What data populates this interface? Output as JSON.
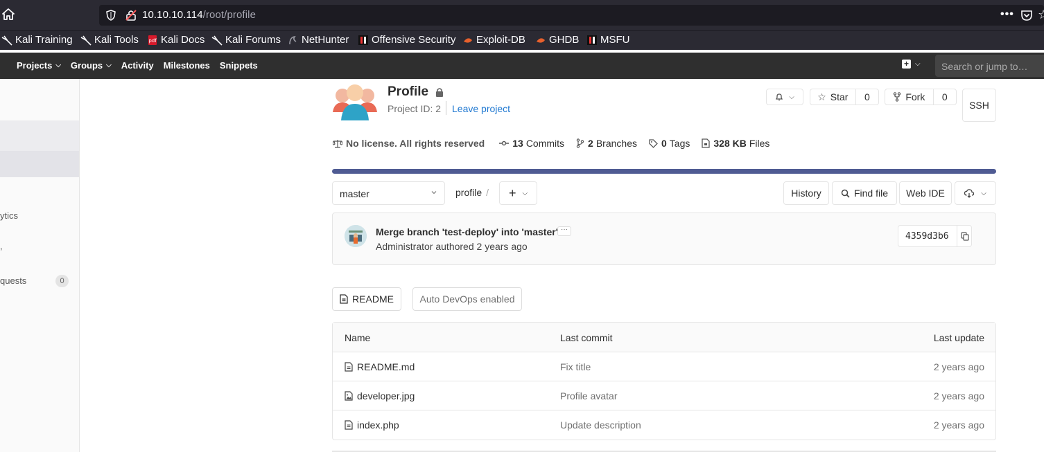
{
  "browser": {
    "url_host": "10.10.10.114",
    "url_path": "/root/profile",
    "bookmarks": [
      {
        "label": "Kali Training",
        "icon": "kali-dragon-icon"
      },
      {
        "label": "Kali Tools",
        "icon": "kali-dragon-icon"
      },
      {
        "label": "Kali Docs",
        "icon": "kali-docs-icon"
      },
      {
        "label": "Kali Forums",
        "icon": "kali-dragon-icon"
      },
      {
        "label": "NetHunter",
        "icon": "nethunter-icon"
      },
      {
        "label": "Offensive Security",
        "icon": "offsec-icon"
      },
      {
        "label": "Exploit-DB",
        "icon": "exploitdb-icon"
      },
      {
        "label": "GHDB",
        "icon": "exploitdb-icon"
      },
      {
        "label": "MSFU",
        "icon": "offsec-icon"
      }
    ]
  },
  "nav": {
    "projects": "Projects",
    "groups": "Groups",
    "activity": "Activity",
    "milestones": "Milestones",
    "snippets": "Snippets",
    "search_placeholder": "Search or jump to…"
  },
  "sidebar": {
    "analytics_fragment": "ytics",
    "comma_fragment": ",",
    "requests_fragment": "quests",
    "requests_count": "0"
  },
  "project": {
    "title": "Profile",
    "id_label": "Project ID: 2",
    "leave_label": "Leave project",
    "star_label": "Star",
    "star_count": "0",
    "fork_label": "Fork",
    "fork_count": "0",
    "ssh_label": "SSH"
  },
  "stats": {
    "license": "No license. All rights reserved",
    "commits_count": "13",
    "commits_label": "Commits",
    "branches_count": "2",
    "branches_label": "Branches",
    "tags_count": "0",
    "tags_label": "Tags",
    "files_size": "328 KB",
    "files_label": "Files"
  },
  "toolbar": {
    "branch": "master",
    "path": "profile",
    "separator": "/",
    "history": "History",
    "find_file": "Find file",
    "web_ide": "Web IDE"
  },
  "commit": {
    "title": "Merge branch 'test-deploy' into 'master'",
    "author": "Administrator authored 2 years ago",
    "sha": "4359d3b6"
  },
  "buttons": {
    "readme": "README",
    "auto_devops": "Auto DevOps enabled"
  },
  "tree": {
    "headers": {
      "name": "Name",
      "last_commit": "Last commit",
      "last_update": "Last update"
    },
    "rows": [
      {
        "name": "README.md",
        "icon": "file-text-icon",
        "commit": "Fix title",
        "date": "2 years ago"
      },
      {
        "name": "developer.jpg",
        "icon": "file-image-icon",
        "commit": "Profile avatar",
        "date": "2 years ago"
      },
      {
        "name": "index.php",
        "icon": "file-text-icon",
        "commit": "Update description",
        "date": "2 years ago"
      }
    ]
  }
}
